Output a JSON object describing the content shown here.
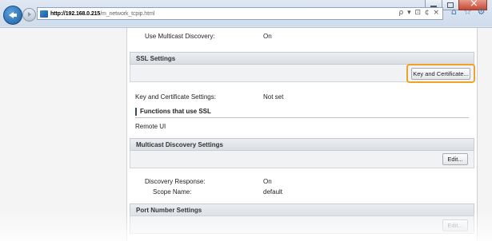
{
  "browser": {
    "url_host": "http://192.168.0.215",
    "url_path": "/m_network_tcpip.html",
    "address_tools": "ρ ▾ ⊡ ¢ ×",
    "icons": [
      "home-icon",
      "favorites-star-icon",
      "settings-gear-icon"
    ]
  },
  "page": {
    "multicast_row": {
      "label": "Use Multicast Discovery:",
      "value": "On"
    },
    "ssl_section": {
      "title": "SSL Settings",
      "button_label": "Key and Certificate...",
      "setting": {
        "label": "Key and Certificate Settings:",
        "value": "Not set"
      },
      "functions_title": "Functions that use SSL",
      "functions": [
        "Remote UI"
      ]
    },
    "multicast_section": {
      "title": "Multicast Discovery Settings",
      "edit_label": "Edit...",
      "rows": [
        {
          "label": "Discovery Response:",
          "value": "On"
        },
        {
          "label": "Scope Name:",
          "value": "default"
        }
      ]
    },
    "port_section": {
      "title": "Port Number Settings",
      "edit_label": "Edit..."
    }
  },
  "colors": {
    "highlight": "#f0a12a",
    "section_header": "#dadee4"
  }
}
